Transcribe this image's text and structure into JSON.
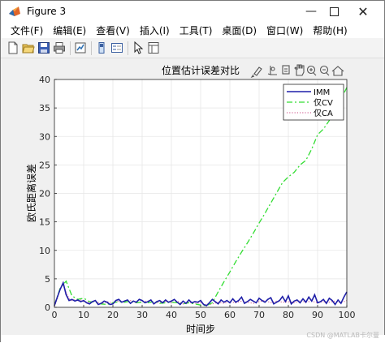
{
  "window": {
    "title": "Figure 3"
  },
  "menu": [
    "文件(F)",
    "编辑(E)",
    "查看(V)",
    "插入(I)",
    "工具(T)",
    "桌面(D)",
    "窗口(W)",
    "帮助(H)"
  ],
  "chart_data": {
    "type": "line",
    "title": "位置估计误差对比",
    "xlabel": "时间步",
    "ylabel": "欧氏距离误差",
    "xlim": [
      0,
      100
    ],
    "ylim": [
      0,
      40
    ],
    "xticks": [
      0,
      10,
      20,
      30,
      40,
      50,
      60,
      70,
      80,
      90,
      100
    ],
    "yticks": [
      0,
      5,
      10,
      15,
      20,
      25,
      30,
      35,
      40
    ],
    "grid": true,
    "legend_position": "top-right",
    "series": [
      {
        "name": "IMM",
        "color": "#1f1fa8",
        "style": "solid",
        "x": [
          0,
          1,
          2,
          3,
          4,
          5,
          6,
          7,
          8,
          9,
          10,
          11,
          12,
          13,
          14,
          15,
          16,
          17,
          18,
          19,
          20,
          21,
          22,
          23,
          24,
          25,
          26,
          27,
          28,
          29,
          30,
          31,
          32,
          33,
          34,
          35,
          36,
          37,
          38,
          39,
          40,
          41,
          42,
          43,
          44,
          45,
          46,
          47,
          48,
          49,
          50,
          51,
          52,
          53,
          54,
          55,
          56,
          57,
          58,
          59,
          60,
          61,
          62,
          63,
          64,
          65,
          66,
          67,
          68,
          69,
          70,
          71,
          72,
          73,
          74,
          75,
          76,
          77,
          78,
          79,
          80,
          81,
          82,
          83,
          84,
          85,
          86,
          87,
          88,
          89,
          90,
          91,
          92,
          93,
          94,
          95,
          96,
          97,
          98,
          99,
          100
        ],
        "y": [
          0.3,
          1.8,
          3.2,
          4.3,
          2.2,
          1.2,
          1.4,
          1.1,
          1.3,
          1.0,
          1.2,
          0.8,
          0.6,
          1.0,
          1.2,
          0.5,
          0.7,
          1.1,
          0.9,
          0.5,
          0.6,
          1.2,
          1.4,
          0.9,
          1.1,
          1.3,
          0.7,
          1.1,
          0.9,
          1.4,
          1.2,
          0.8,
          1.0,
          1.3,
          0.6,
          1.0,
          1.2,
          0.8,
          1.3,
          0.9,
          1.1,
          1.4,
          0.9,
          0.5,
          1.1,
          0.7,
          1.3,
          0.8,
          1.0,
          0.9,
          1.2,
          0.5,
          0.3,
          0.8,
          1.4,
          1.0,
          0.6,
          1.3,
          0.9,
          1.2,
          0.8,
          1.5,
          0.9,
          1.2,
          1.8,
          0.7,
          1.0,
          1.4,
          1.1,
          0.8,
          1.6,
          1.2,
          0.9,
          1.4,
          1.7,
          0.6,
          0.9,
          1.2,
          1.9,
          1.0,
          2.0,
          0.6,
          1.1,
          1.3,
          0.8,
          1.5,
          0.9,
          1.8,
          1.1,
          2.2,
          0.8,
          1.0,
          1.4,
          0.7,
          1.6,
          1.2,
          0.5,
          1.3,
          0.7,
          1.8,
          2.7
        ]
      },
      {
        "name": "仅CV",
        "color": "#33dd33",
        "style": "dashdot",
        "x": [
          0,
          2,
          4,
          6,
          8,
          10,
          12,
          14,
          16,
          18,
          20,
          22,
          24,
          26,
          28,
          30,
          32,
          34,
          36,
          38,
          40,
          42,
          44,
          46,
          48,
          50,
          52,
          54,
          56,
          58,
          60,
          62,
          64,
          66,
          68,
          70,
          72,
          74,
          76,
          78,
          80,
          82,
          84,
          86,
          88,
          90,
          92,
          94,
          96,
          98,
          100
        ],
        "y": [
          0.4,
          3.4,
          4.6,
          2.0,
          1.4,
          1.6,
          1.0,
          0.9,
          0.6,
          0.5,
          0.8,
          1.0,
          0.9,
          1.1,
          0.8,
          0.9,
          0.8,
          1.0,
          0.7,
          0.8,
          0.9,
          0.8,
          0.6,
          0.8,
          0.6,
          0.4,
          0.3,
          0.8,
          2.7,
          4.5,
          6.2,
          8.0,
          9.7,
          11.3,
          13.0,
          14.8,
          16.5,
          18.3,
          20.1,
          21.9,
          22.9,
          23.7,
          25.0,
          25.8,
          27.8,
          30.3,
          31.3,
          32.8,
          34.8,
          36.5,
          38.6
        ]
      },
      {
        "name": "仅CA",
        "color": "#d46a9a",
        "style": "dotted",
        "x": [
          0,
          1,
          2,
          3,
          4,
          5,
          6,
          7,
          8,
          9,
          10,
          12,
          14,
          16,
          18,
          20,
          22,
          24,
          26,
          28,
          30,
          32,
          34,
          36,
          38,
          40,
          42,
          44,
          46,
          48,
          50,
          52,
          54,
          56,
          58,
          60,
          62,
          64,
          66,
          68,
          70,
          72,
          74,
          76,
          78,
          80,
          82,
          84,
          86,
          88,
          90,
          92,
          94,
          96,
          98,
          100
        ],
        "y": [
          0.2,
          1.5,
          3.4,
          4.0,
          2.6,
          1.5,
          1.2,
          1.4,
          1.1,
          1.3,
          1.0,
          0.9,
          1.1,
          0.6,
          1.0,
          0.8,
          1.1,
          0.9,
          1.2,
          0.8,
          1.0,
          1.1,
          0.7,
          0.9,
          1.0,
          0.8,
          1.1,
          0.6,
          0.9,
          0.7,
          0.8,
          0.4,
          0.6,
          0.9,
          0.7,
          1.0,
          0.8,
          1.1,
          0.9,
          0.7,
          1.0,
          1.2,
          0.8,
          1.1,
          0.9,
          1.0,
          0.8,
          1.2,
          0.9,
          1.1,
          0.8,
          1.0,
          0.9,
          1.1,
          0.8,
          1.2
        ]
      }
    ]
  },
  "footer": {
    "watermark": "CSDN @MATLAB卡尔曼"
  }
}
